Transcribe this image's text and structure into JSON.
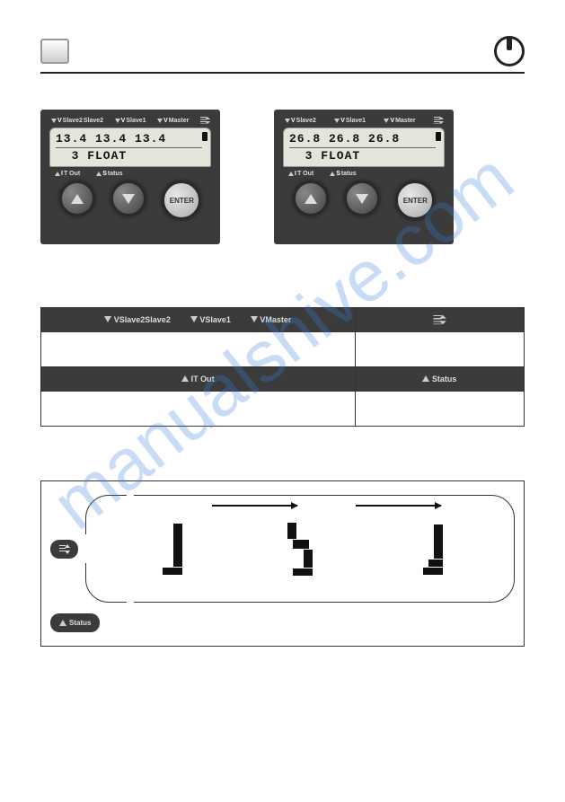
{
  "watermark": "manualshive.com",
  "panel_labels": {
    "vslave2": "VSlave2",
    "vslave1": "VSlave1",
    "vmaster": "VMaster",
    "itout": "IT Out",
    "status": "Status"
  },
  "panels": [
    {
      "line1": "13.4 13.4 13.4",
      "line2": "  3 FLOAT"
    },
    {
      "line1": "26.8 26.8 26.8",
      "line2": "  3 FLOAT"
    }
  ],
  "buttons": {
    "enter": "ENTER"
  },
  "diagram": {
    "status_label": "Status"
  }
}
